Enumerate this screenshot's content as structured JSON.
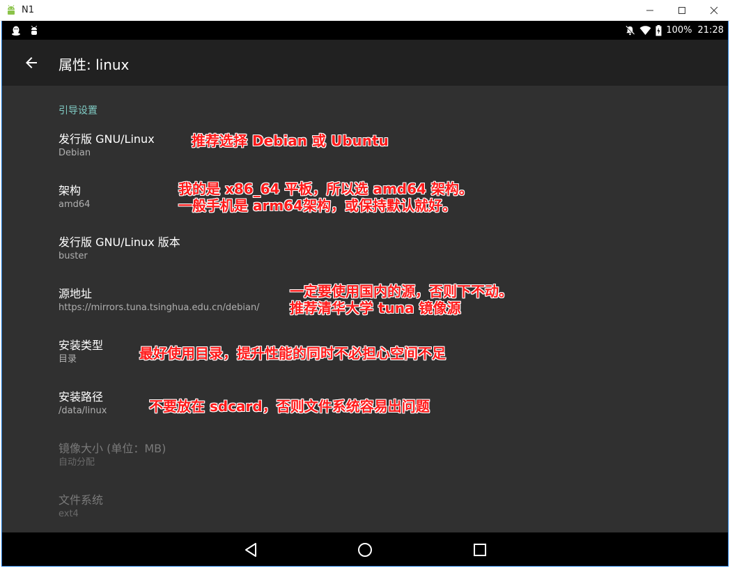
{
  "window": {
    "title": "N1",
    "controls": [
      "minimize-icon",
      "maximize-icon",
      "close-icon"
    ]
  },
  "statusbar": {
    "left_icons": [
      "qq-penguin-icon",
      "android-debug-icon"
    ],
    "right_icons": [
      "mute-icon",
      "wifi-icon",
      "battery-charging-icon"
    ],
    "battery": "100%",
    "time": "21:28"
  },
  "appbar": {
    "title": "属性: linux"
  },
  "settings": {
    "section": "引导设置",
    "items": [
      {
        "title": "发行版 GNU/Linux",
        "summary": "Debian",
        "enabled": true
      },
      {
        "title": "架构",
        "summary": "amd64",
        "enabled": true
      },
      {
        "title": "发行版 GNU/Linux 版本",
        "summary": "buster",
        "enabled": true
      },
      {
        "title": "源地址",
        "summary": "https://mirrors.tuna.tsinghua.edu.cn/debian/",
        "enabled": true
      },
      {
        "title": "安装类型",
        "summary": "目录",
        "enabled": true
      },
      {
        "title": "安装路径",
        "summary": "/data/linux",
        "enabled": true
      },
      {
        "title": "镜像大小 (单位：MB)",
        "summary": "自动分配",
        "enabled": false
      },
      {
        "title": "文件系统",
        "summary": "ext4",
        "enabled": false
      }
    ]
  },
  "annotations": [
    {
      "lines": [
        "推荐选择 Debian 或 Ubuntu"
      ]
    },
    {
      "lines": [
        "我的是 x86_64 平板，所以选 amd64 架构。",
        "一般手机是 arm64架构，或保持默认就好。"
      ]
    },
    {
      "lines": [
        "一定要使用国内的源，否则下不动。",
        "推荐清华大学 tuna 镜像源"
      ]
    },
    {
      "lines": [
        "最好使用目录，提升性能的同时不必担心空间不足"
      ]
    },
    {
      "lines": [
        "不要放在 sdcard，否则文件系统容易出问题"
      ]
    }
  ],
  "colors": {
    "background": "#303030",
    "appbar": "#212121",
    "accent": "#80cbc4",
    "annotation": "#ff1a1a"
  },
  "navbar": {
    "buttons": [
      "back-triangle-icon",
      "home-circle-icon",
      "recents-square-icon"
    ]
  }
}
